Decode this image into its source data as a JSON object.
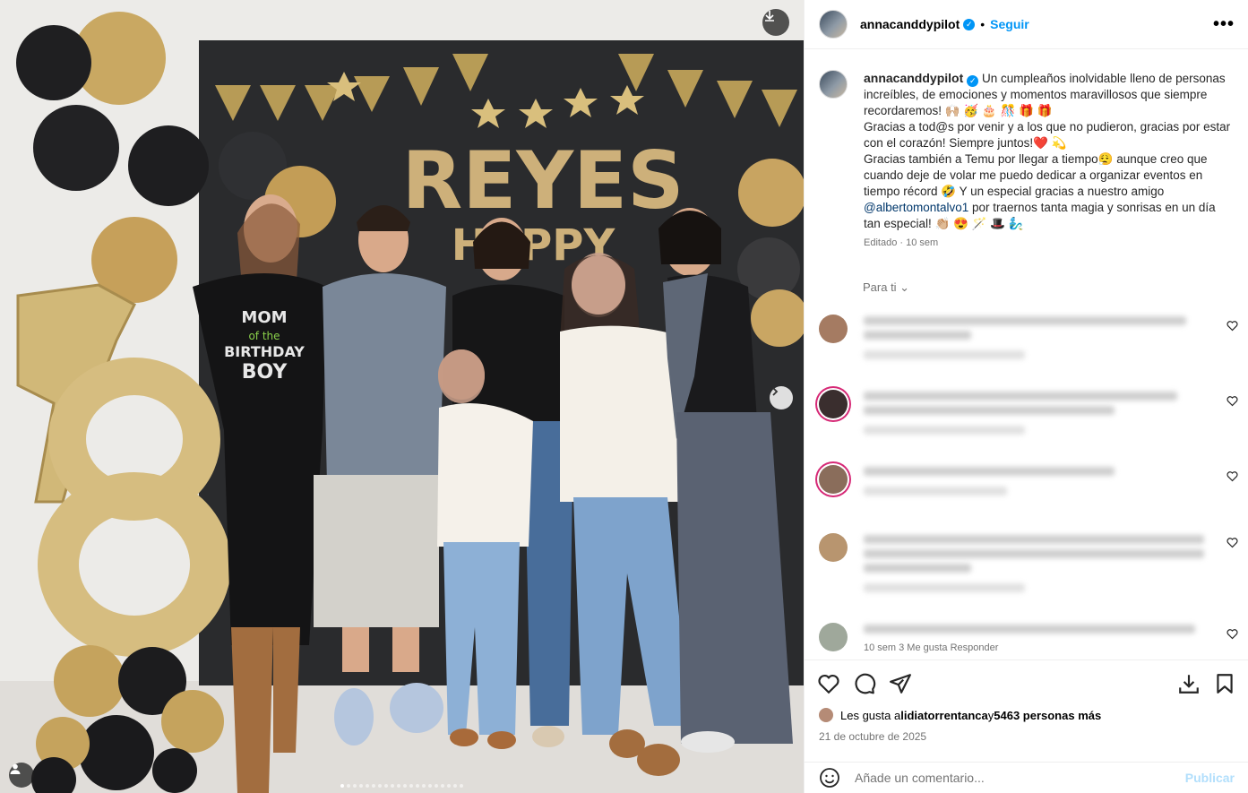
{
  "post": {
    "username": "annacanddypilot",
    "follow_label": "Seguir",
    "separator": "•",
    "more_label": "•••",
    "verified_glyph": "✓"
  },
  "photo": {
    "banner_text": "REYES",
    "banner_subtext": "HAPPY",
    "shirt_lines": [
      "MOM",
      "of the",
      "BIRTHDAY",
      "BOY"
    ],
    "carousel_index": 1,
    "carousel_count": 20,
    "icons": [
      "download-icon",
      "chevron-right-icon",
      "user-icon"
    ]
  },
  "caption": {
    "text_1": " Un cumpleaños inolvidable lleno de personas increíbles, de emociones y momentos maravillosos que siempre recordaremos! 🙌🏼 🥳 🎂 🎊 🎁 🎁",
    "text_2": "Gracias a tod@s por venir y a los que no pudieron, gracias por estar con el corazón! Siempre juntos!❤️ 💫",
    "text_3": "Gracias también a Temu por llegar a tiempo😮‍💨 aunque creo que cuando deje de volar me puedo dedicar a organizar eventos en tiempo récord 🤣 Y un especial gracias a nuestro amigo",
    "mention": "@albertomontalvo1",
    "text_4": " por traernos tanta magia y sonrisas en un día tan especial! 👏🏼 😍 🪄 🎩 🧞‍♂️",
    "edited": "Editado · 10 sem"
  },
  "comments_section": {
    "sort_label": "Para ti ⌄",
    "footer_visible": "10 sem    3 Me gusta    Responder"
  },
  "actions": {
    "icons": [
      "heart-icon",
      "comment-icon",
      "share-icon",
      "download-icon",
      "bookmark-icon"
    ]
  },
  "likes": {
    "prefix": "Les gusta a ",
    "user": "lidiatorrentanca",
    "middle": " y ",
    "count": "5463 personas más"
  },
  "date": "21 de octubre de 2025",
  "add_comment": {
    "placeholder": "Añade un comentario...",
    "publish_label": "Publicar"
  },
  "colors": {
    "link": "#0095f6",
    "mention": "#00376b",
    "muted": "#737373"
  }
}
